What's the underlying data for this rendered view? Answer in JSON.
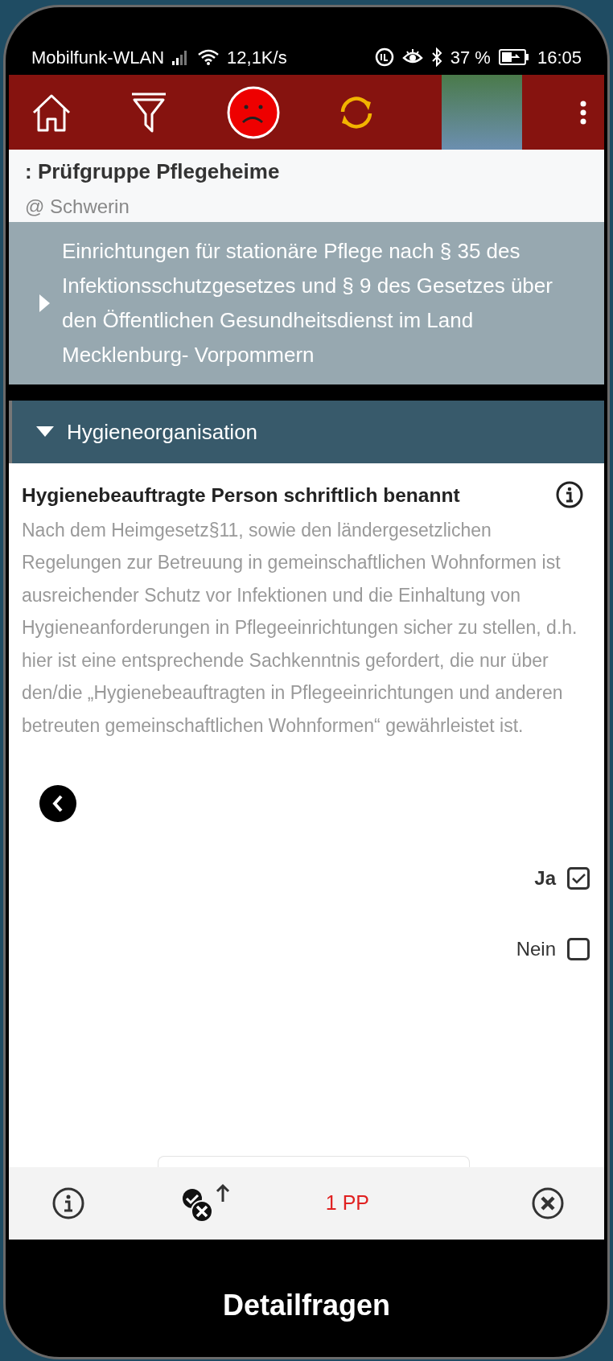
{
  "status_bar": {
    "carrier": "Mobilfunk-WLAN",
    "speed": "12,1K/s",
    "battery": "37 %",
    "time": "16:05"
  },
  "toolbar": {
    "satisfied": false
  },
  "header": {
    "title": ": Prüfgruppe Pflegeheime",
    "subtitle": "@ Schwerin"
  },
  "sections": [
    {
      "expanded": false,
      "text": "Einrichtungen für stationäre Pflege nach § 35 des Infektionsschutzgesetzes und § 9 des Gesetzes über den Öffentlichen Gesundheitsdienst im Land Mecklenburg- Vorpommern"
    },
    {
      "expanded": true,
      "text": "Hygieneorganisation"
    }
  ],
  "question": {
    "title": "Hygienebeauftragte Person schriftlich benannt",
    "description": "Nach dem Heimgesetz§11, sowie den ländergesetzlichen Regelungen zur Betreuung in gemeinschaftlichen Wohnformen ist ausreichender Schutz vor Infektionen und die Einhaltung von Hygieneanforderungen in Pflegeeinrichtungen sicher zu stellen, d.h. hier ist eine entsprechende Sachkenntnis gefordert, die nur über den/die „Hygienebeauftragten in Pflegeeinrichtungen und anderen betreuten gemeinschaftlichen Wohnformen“ gewährleistet ist.",
    "options": [
      {
        "label": "Ja",
        "checked": true
      },
      {
        "label": "Nein",
        "checked": false
      }
    ]
  },
  "bottom_bar": {
    "points": "1 PP"
  },
  "footer": {
    "title": "Detailfragen"
  }
}
